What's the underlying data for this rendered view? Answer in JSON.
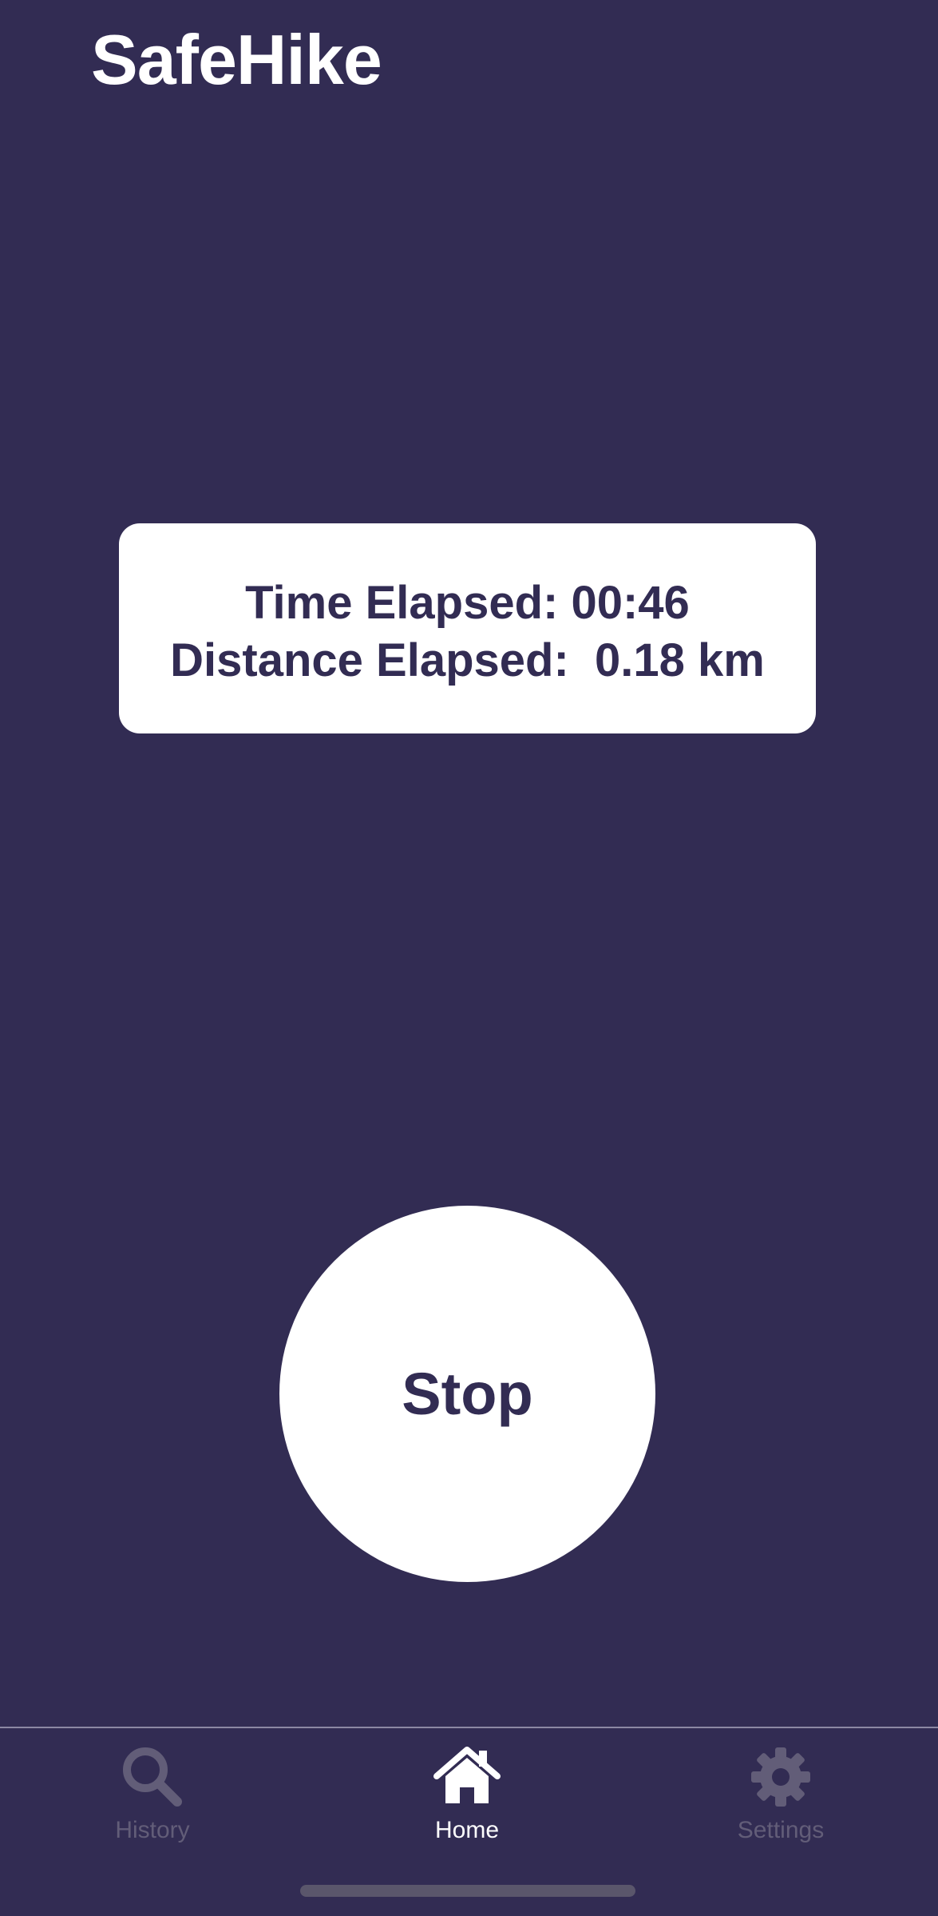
{
  "app": {
    "title": "SafeHike"
  },
  "stats": {
    "time_line": "Time Elapsed: 00:46",
    "distance_line": "Distance Elapsed:  0.18 km"
  },
  "actions": {
    "stop_label": "Stop"
  },
  "tabs": [
    {
      "label": "History",
      "icon": "search-icon",
      "active": false
    },
    {
      "label": "Home",
      "icon": "home-icon",
      "active": true
    },
    {
      "label": "Settings",
      "icon": "gear-icon",
      "active": false
    }
  ],
  "colors": {
    "background": "#322c53",
    "card": "#ffffff",
    "text_dark": "#322c53",
    "tab_inactive": "#625d78",
    "tab_active": "#ffffff"
  }
}
